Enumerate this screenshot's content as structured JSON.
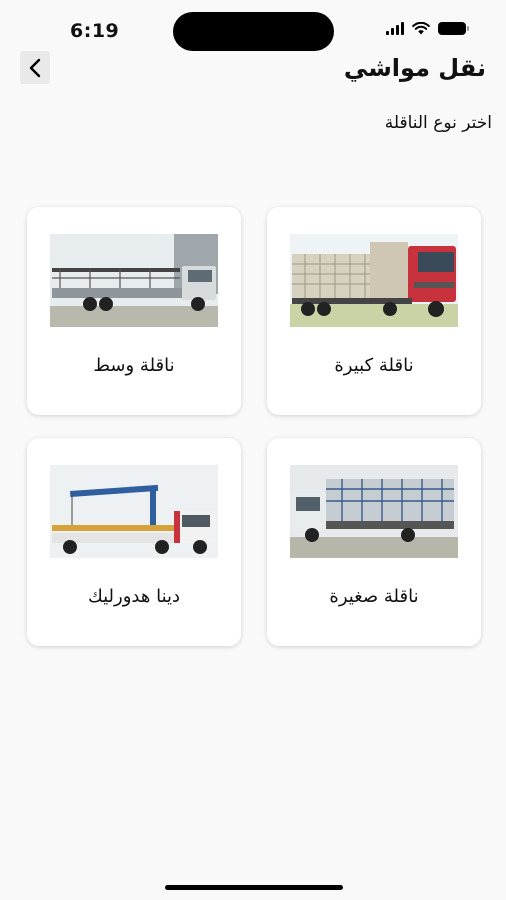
{
  "status_bar": {
    "time": "6:19"
  },
  "header": {
    "title": "نقل مواشي",
    "back_icon": "chevron-left-icon"
  },
  "subtitle": "اختر نوع الناقلة",
  "cards": [
    {
      "label": "ناقلة كبيرة",
      "image": "large-livestock-truck"
    },
    {
      "label": "ناقلة وسط",
      "image": "medium-flatbed-truck"
    },
    {
      "label": "ناقلة صغيرة",
      "image": "small-cage-truck"
    },
    {
      "label": "دينا هدورليك",
      "image": "hydraulic-crane-truck"
    }
  ],
  "colors": {
    "background": "#f9f9f9",
    "card": "#ffffff",
    "accent_red": "#c8323c",
    "crane_blue": "#2f5f9e"
  }
}
